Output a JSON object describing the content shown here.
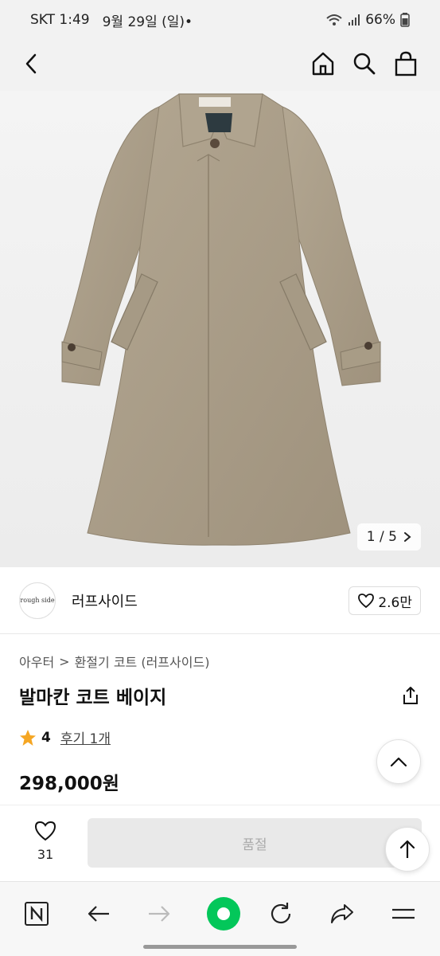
{
  "status_bar": {
    "carrier_time": "SKT 1:49",
    "date": "9월 29일 (일)",
    "dot": "•",
    "battery": "66%"
  },
  "gallery": {
    "current": "1",
    "separator": "/",
    "total": "5"
  },
  "seller": {
    "logo_text": "rough side",
    "name": "러프사이드",
    "likes": "2.6만"
  },
  "breadcrumb": {
    "category": "아우터",
    "separator": ">",
    "subcategory": "환절기 코트 (러프사이드)"
  },
  "product": {
    "title": "발마칸 코트 베이지",
    "rating": "4",
    "review_label": "후기 1개",
    "price": "298,000원"
  },
  "cta": {
    "wish_count": "31",
    "soldout_label": "품절"
  },
  "icons": {
    "back": "chevron-left-icon",
    "home": "home-icon",
    "search": "search-icon",
    "cart": "shopping-bag-icon",
    "share": "share-icon",
    "star": "star-icon",
    "heart": "heart-icon",
    "scroll_top": "chevron-up-icon",
    "arrow_up": "arrow-up-icon"
  },
  "colors": {
    "star": "#f5a623",
    "browser_green": "#03c75a",
    "coat": "#a99c88"
  }
}
